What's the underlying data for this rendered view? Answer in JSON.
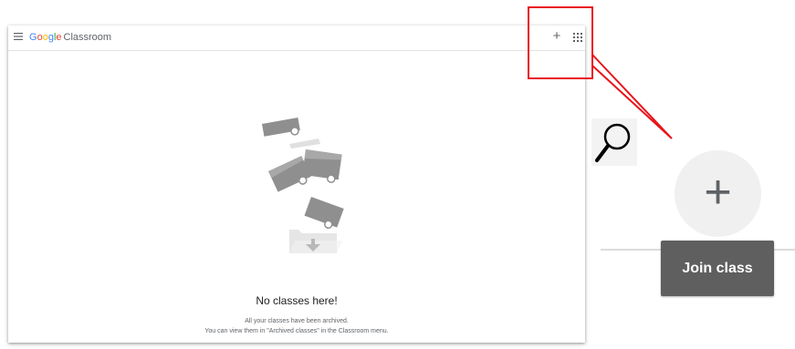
{
  "app": {
    "brand_letters": [
      "G",
      "o",
      "o",
      "g",
      "l",
      "e"
    ],
    "product": "Classroom",
    "add_label": "+",
    "menu_icon": "hamburger-icon",
    "apps_icon": "apps-grid-icon"
  },
  "empty_state": {
    "title": "No classes here!",
    "line1": "All your classes have been archived.",
    "line2": "You can view them in \"Archived classes\" in the Classroom menu."
  },
  "zoom": {
    "plus_label": "+",
    "tooltip": "Join class",
    "magnifier_icon": "magnifier-icon"
  },
  "colors": {
    "google_blue": "#4285F4",
    "google_red": "#EA4335",
    "google_yellow": "#FBBC05",
    "google_green": "#34A853",
    "callout_red": "#e8141a",
    "tooltip_bg": "#5f5f5f"
  }
}
